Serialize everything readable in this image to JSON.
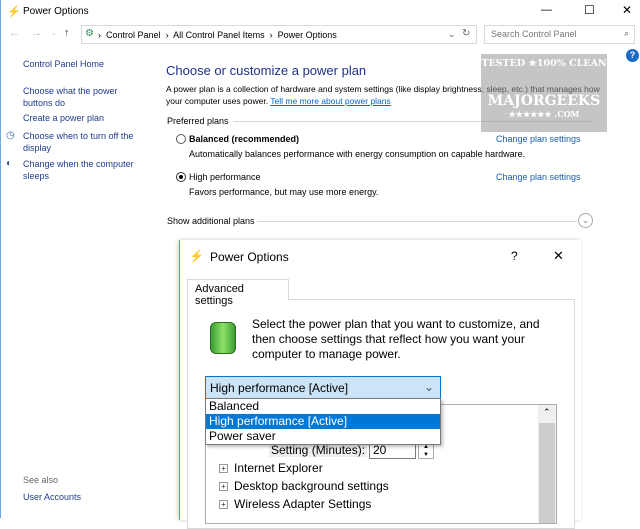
{
  "window": {
    "title": "Power Options",
    "minimize": "—",
    "maximize": "☐",
    "close": "✕"
  },
  "address": {
    "breadcrumb": [
      "Control Panel",
      "All Control Panel Items",
      "Power Options"
    ],
    "sep": "›",
    "search_placeholder": "Search Control Panel"
  },
  "sidebar": {
    "home": "Control Panel Home",
    "items": [
      "Choose what the power buttons do",
      "Create a power plan",
      "Choose when to turn off the display",
      "Change when the computer sleeps"
    ],
    "see_also": "See also",
    "see_also_items": [
      "User Accounts"
    ]
  },
  "main": {
    "heading": "Choose or customize a power plan",
    "intro": "A power plan is a collection of hardware and system settings (like display brightness, sleep, etc.) that manages how your computer uses power.",
    "intro_link": "Tell me more about power plans",
    "preferred_plans": "Preferred plans",
    "plans": [
      {
        "name": "Balanced (recommended)",
        "desc": "Automatically balances performance with energy consumption on capable hardware.",
        "selected": false,
        "link": "Change plan settings"
      },
      {
        "name": "High performance",
        "desc": "Favors performance, but may use more energy.",
        "selected": true,
        "link": "Change plan settings"
      }
    ],
    "show_additional": "Show additional plans"
  },
  "watermark": {
    "line1": "TESTED ★100% CLEAN",
    "line2": "MAJORGEEKS",
    ".com": ".COM"
  },
  "dialog": {
    "title": "Power Options",
    "help": "?",
    "close": "✕",
    "tab": "Advanced settings",
    "description": "Select the power plan that you want to customize, and then choose settings that reflect how you want your computer to manage power.",
    "dropdown_value": "High performance [Active]",
    "options": [
      "Balanced",
      "High performance [Active]",
      "Power saver"
    ],
    "selected_option": 1,
    "setting_label": "Setting (Minutes):",
    "setting_value": "20",
    "tree_items": [
      "Internet Explorer",
      "Desktop background settings",
      "Wireless Adapter Settings"
    ]
  }
}
